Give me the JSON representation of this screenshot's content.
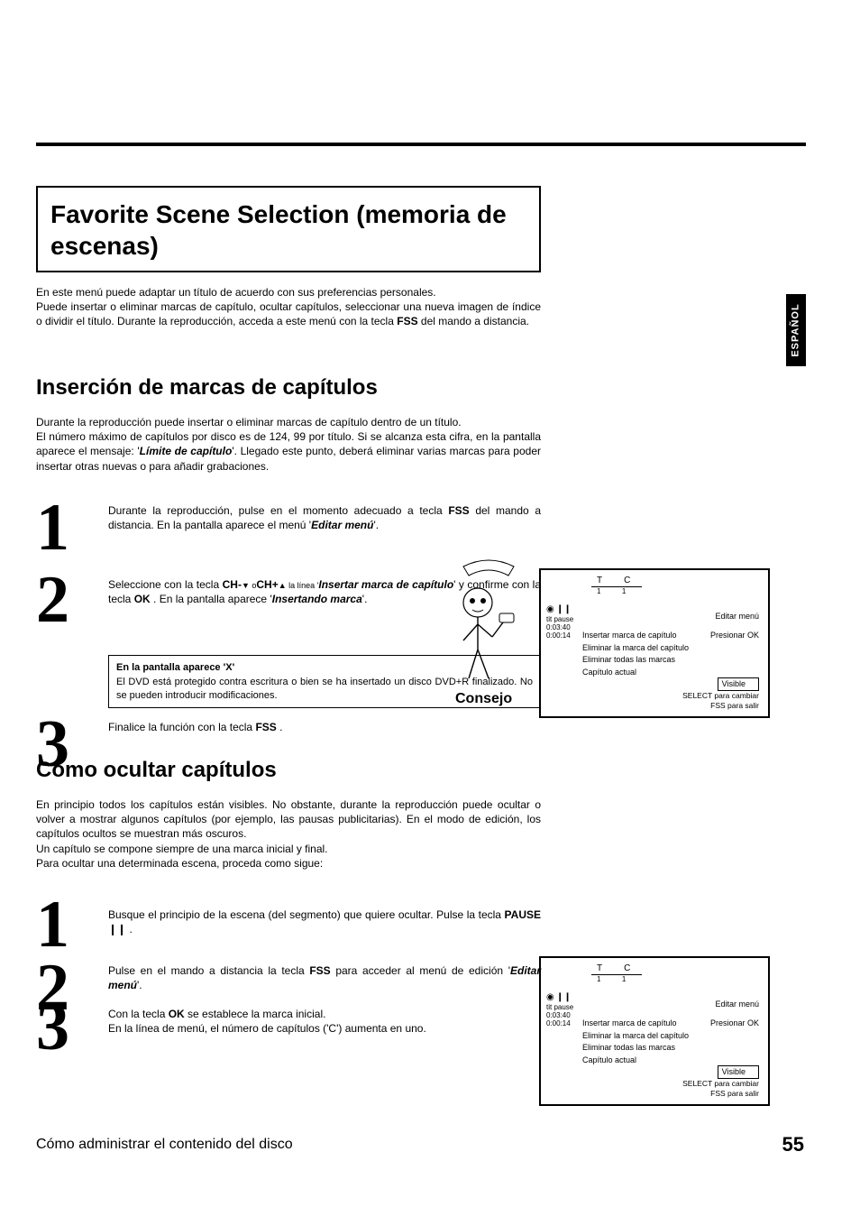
{
  "sidetab": "ESPAÑOL",
  "titlebox": "Favorite Scene Selection (memoria de escenas)",
  "intro": {
    "l1": "En este menú puede adaptar un título de acuerdo con sus preferencias personales.",
    "l2a": "Puede insertar o eliminar marcas de capítulo, ocultar capítulos, seleccionar una nueva imagen de índice o dividir el título. Durante la reproducción, acceda a este menú con la tecla ",
    "fss": "FSS",
    "l2b": " del mando a distancia."
  },
  "h2a": "Inserción de marcas de capítulos",
  "para2": "Durante la reproducción puede insertar o eliminar marcas de capítulo dentro de un título.\nEl número máximo de capítulos por disco es de 124, 99 por título. Si se alcanza esta cifra, en la pantalla aparece el mensaje: 'Límite de capítulo'. Llegado este punto, deberá eliminar varias marcas para poder insertar otras nuevas o para añadir grabaciones.",
  "steps_a": {
    "s1": {
      "pre": "Durante la reproducción, pulse en el momento adecuado a tecla ",
      "b1": "FSS",
      "mid": " del mando a distancia. En la pantalla aparece el menú '",
      "bi": "Editar menú",
      "post": "'."
    },
    "s2": {
      "pre": "Seleccione con la tecla ",
      "b1": "CH-",
      "mid1": " ▼ o ",
      "b2": "CH+",
      "mid2": " ▲ la línea '",
      "bi1": "Insertar marca de capítulo",
      "mid3": "' y confirme con la tecla ",
      "b3": "OK",
      "mid4": " . En la pantalla aparece '",
      "bi2": "Insertando marca",
      "post": "'."
    },
    "s3": {
      "pre": "Finalice la función con la tecla ",
      "b1": "FSS",
      "post": " ."
    }
  },
  "tip": {
    "head": "En la pantalla aparece 'X'",
    "body": "El DVD está protegido contra escritura o bien se ha insertado un disco DVD+R finalizado. No se pueden introducir modificaciones."
  },
  "consejo": "Consejo",
  "h2b": "Cómo ocultar capítulos",
  "para3": "En principio todos los capítulos están visibles. No obstante, durante la reproducción puede ocultar o volver a mostrar algunos capítulos (por ejemplo, las pausas publicitarias). En el modo de edición, los capítulos ocultos se muestran más oscuros.\nUn capítulo se compone siempre de una marca inicial y final.\nPara ocultar una determinada escena, proceda como sigue:",
  "steps_b": {
    "s1": {
      "pre": "Busque el principio de la escena (del segmento) que quiere ocultar. Pulse la tecla ",
      "b1": "PAUSE",
      "icon": " ❙❙ ",
      "post": " ."
    },
    "s2": {
      "pre": "Pulse en el mando a distancia la tecla ",
      "b1": "FSS",
      "mid": " para acceder al menú de edición '",
      "bi": "Editar menú",
      "post": "'."
    },
    "s3": {
      "l1pre": "Con la tecla ",
      "b1": "OK",
      "l1post": " se establece la marca inicial.",
      "l2": "En la línea de menú, el número de capítulos ('C') aumenta en uno."
    }
  },
  "osd": {
    "tc_letters": "TC",
    "tc_nums": "11",
    "pause_row": "❙❙",
    "tit_pause": "tit   pause",
    "time1": "0:03:40",
    "time2": "0:00:14",
    "menutitle": "Editar menú",
    "items": {
      "i1": "Insertar marca de capítulo",
      "i2": "Eliminar la marca del capítulo",
      "i3": "Eliminar todas las marcas",
      "i4": "Capítulo actual"
    },
    "pressok": "Presionar OK",
    "visible": "Visible",
    "note1": "SELECT para cambiar",
    "note2": "FSS para salir"
  },
  "footer": {
    "left": "Cómo administrar el contenido del disco",
    "right": "55"
  }
}
